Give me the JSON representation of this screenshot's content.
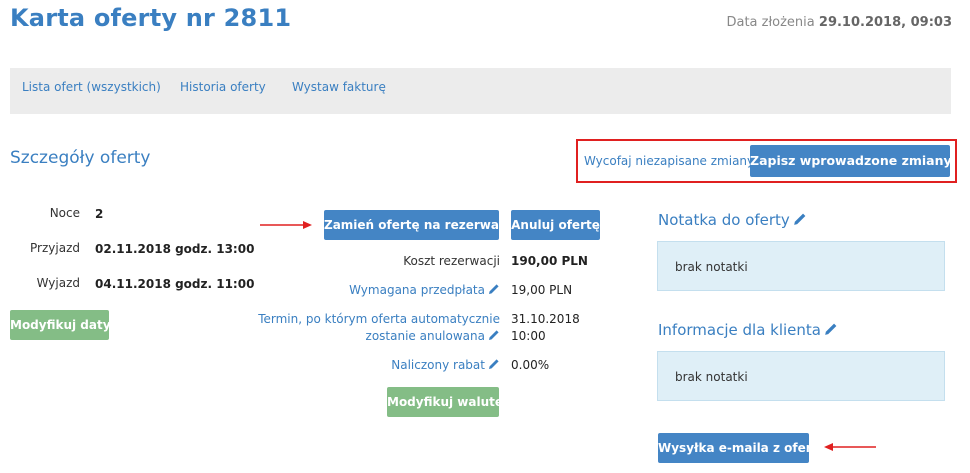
{
  "header": {
    "title": "Karta oferty nr 2811",
    "date_label": "Data złożenia",
    "date_value": "29.10.2018, 09:03"
  },
  "nav": {
    "items": [
      {
        "label": "Lista ofert (wszystkich)"
      },
      {
        "label": "Historia oferty"
      },
      {
        "label": "Wystaw fakturę"
      }
    ]
  },
  "details": {
    "title": "Szczegóły oferty",
    "discard_label": "Wycofaj niezapisane zmiany",
    "save_label": "Zapisz wprowadzone zmiany"
  },
  "stay": {
    "nights_label": "Noce",
    "nights_value": "2",
    "arrival_label": "Przyjazd",
    "arrival_value": "02.11.2018 godz. 13:00",
    "departure_label": "Wyjazd",
    "departure_value": "04.11.2018 godz. 11:00",
    "modify_dates_label": "Modyfikuj daty"
  },
  "offer": {
    "convert_label": "Zamień ofertę na rezerwację",
    "cancel_label": "Anuluj ofertę",
    "cost_label": "Koszt rezerwacji",
    "cost_value": "190,00 PLN",
    "prepayment_label": "Wymagana przedpłata",
    "prepayment_value": "19,00 PLN",
    "deadline_label_1": "Termin, po którym oferta automatycznie",
    "deadline_label_2": "zostanie anulowana",
    "deadline_date": "31.10.2018",
    "deadline_time": "10:00",
    "discount_label": "Naliczony rabat",
    "discount_value": "0.00%",
    "modify_currency_label": "Modyfikuj walutę"
  },
  "notes": {
    "offer_note_title": "Notatka do oferty",
    "offer_note_text": "brak notatki",
    "client_info_title": "Informacje dla klienta",
    "client_info_text": "brak notatki",
    "send_email_label": "Wysyłka e-maila z ofertą"
  },
  "colors": {
    "accent": "#3a7fc1",
    "button_blue": "#4485c5",
    "button_green": "#84bd86",
    "highlight_red": "#e02020",
    "note_bg": "#dfeff7"
  }
}
